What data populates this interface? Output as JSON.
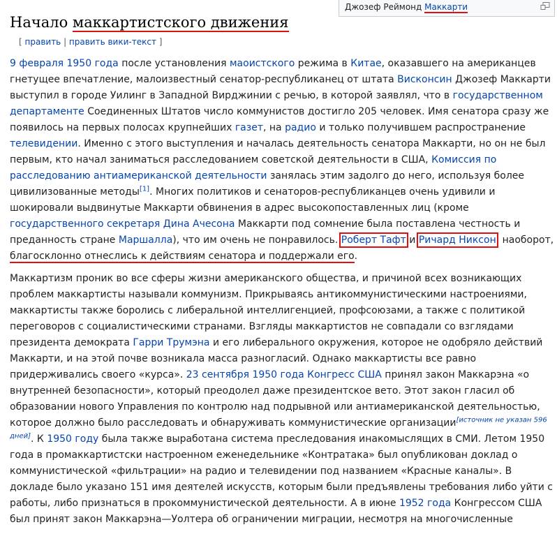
{
  "caption": {
    "before": "Джозеф Реймонд ",
    "highlight": "Маккарти"
  },
  "heading": {
    "before": "Начало ",
    "highlight": "маккартистского движения"
  },
  "edit": {
    "open": "[ ",
    "edit_label": "править",
    "sep": " | ",
    "edit_source_label": "править вики-текст",
    "close": " ]"
  },
  "p1": [
    {
      "t": "9 февраля",
      "link": true
    },
    {
      "t": " "
    },
    {
      "t": "1950 года",
      "link": true
    },
    {
      "t": " после установления "
    },
    {
      "t": "маоистского",
      "link": true
    },
    {
      "t": " режима в "
    },
    {
      "t": "Китае",
      "link": true
    },
    {
      "t": ", оказавшего на американцев гнетущее впечатление, малоизвестный сенатор-республиканец от штата "
    },
    {
      "t": "Висконсин",
      "link": true
    },
    {
      "t": " Джозеф Маккарти выступил в городе Уилинг в Западной Вирджинии с речью, в которой заявлял, что в "
    },
    {
      "t": "государственном департаменте",
      "link": true
    },
    {
      "t": " Соединенных Штатов число коммунистов достигло 205 человек. Имя сенатора сразу же появилось на первых полосах крупнейших "
    },
    {
      "t": "газет",
      "link": true
    },
    {
      "t": ", на "
    },
    {
      "t": "радио",
      "link": true
    },
    {
      "t": " и только получившем распространение "
    },
    {
      "t": "телевидении",
      "link": true
    },
    {
      "t": ". Именно с этого выступления и началась деятельность сенатора Маккарти, но он не был первым, кто начал заниматься расследованием советской деятельности в США, "
    },
    {
      "t": "Комиссия по расследованию антиамериканской деятельности",
      "link": true
    },
    {
      "t": " занялась этим задолго до него, используя более цивилизованные методы"
    },
    {
      "t": "[1]",
      "link": true,
      "sup": "ref"
    },
    {
      "t": ". Многих политиков и сенаторов-республиканцев очень удивили и шокировали выдвинутые Маккарти обвинения в адрес высокопоставленных лиц (кроме "
    },
    {
      "t": "государственного секретаря",
      "link": true
    },
    {
      "t": " "
    },
    {
      "t": "Дина Ачесона",
      "link": true
    },
    {
      "t": " Маккарти под сомнение была поставлена честность и преданность стране "
    },
    {
      "t": "Маршалла",
      "link": true
    },
    {
      "t": "), что им очень не понравилось. "
    },
    {
      "t": "Роберт Тафт",
      "link": true,
      "hl": "box"
    },
    {
      "t": " и "
    },
    {
      "t": "Ричард Никсон",
      "link": true,
      "hl": "box"
    },
    {
      "t": ", наоборот, "
    },
    {
      "t": "благосклонно отнеслись к действиям сенатора и поддержали его",
      "hl": "line"
    },
    {
      "t": "."
    }
  ],
  "p2": [
    {
      "t": "Маккартизм проник во все сферы жизни американского общества, и причиной всех возникающих проблем маккартисты называли коммунизм. Прикрываясь антикоммунистическими настроениями, маккартисты также боролись с либеральной интеллигенцией, профсоюзами, а также с политикой переговоров с социалистическими странами. Взгляды маккартистов не совпадали со взглядами президента демократа "
    },
    {
      "t": "Гарри Трумэна",
      "link": true
    },
    {
      "t": " и его либерального окружения, которое не одобряло действий Маккарти, и на этой почве возникала масса разногласий. Однако маккартисты все равно придерживались своего «курса». "
    },
    {
      "t": "23 сентября",
      "link": true
    },
    {
      "t": " "
    },
    {
      "t": "1950 года",
      "link": true
    },
    {
      "t": " "
    },
    {
      "t": "Конгресс США",
      "link": true
    },
    {
      "t": " принял закон Маккарэна «о внутренней безопасности», который преодолел даже президентское вето. Этот закон гласил об образовании нового Управления по контролю над подрывной или антиамериканской деятельностью, которое должно было расследовать и обнаруживать коммунистические организации"
    },
    {
      "t": "[источник не указан 596 дней]",
      "link": true,
      "sup": "note"
    },
    {
      "t": ". К "
    },
    {
      "t": "1950 году",
      "link": true
    },
    {
      "t": " была также выработана система преследования инакомыслящих в СМИ. Летом 1950 года в промаккартистски настроенном еженедельнике «Контратака» был опубликован доклад о коммунистической «фильтрации» на радио и телевидении под названием «Красные каналы». В докладе было указано 151 имя деятелей искусств, которым были предъявлены требования либо уйти с работы, либо признаться в прокоммунистической деятельности. А в июне "
    },
    {
      "t": "1952 года",
      "link": true
    },
    {
      "t": " Конгрессом США был принят закон Маккарэна—Уолтера об ограничении миграции, несмотря на многочисленные"
    }
  ]
}
